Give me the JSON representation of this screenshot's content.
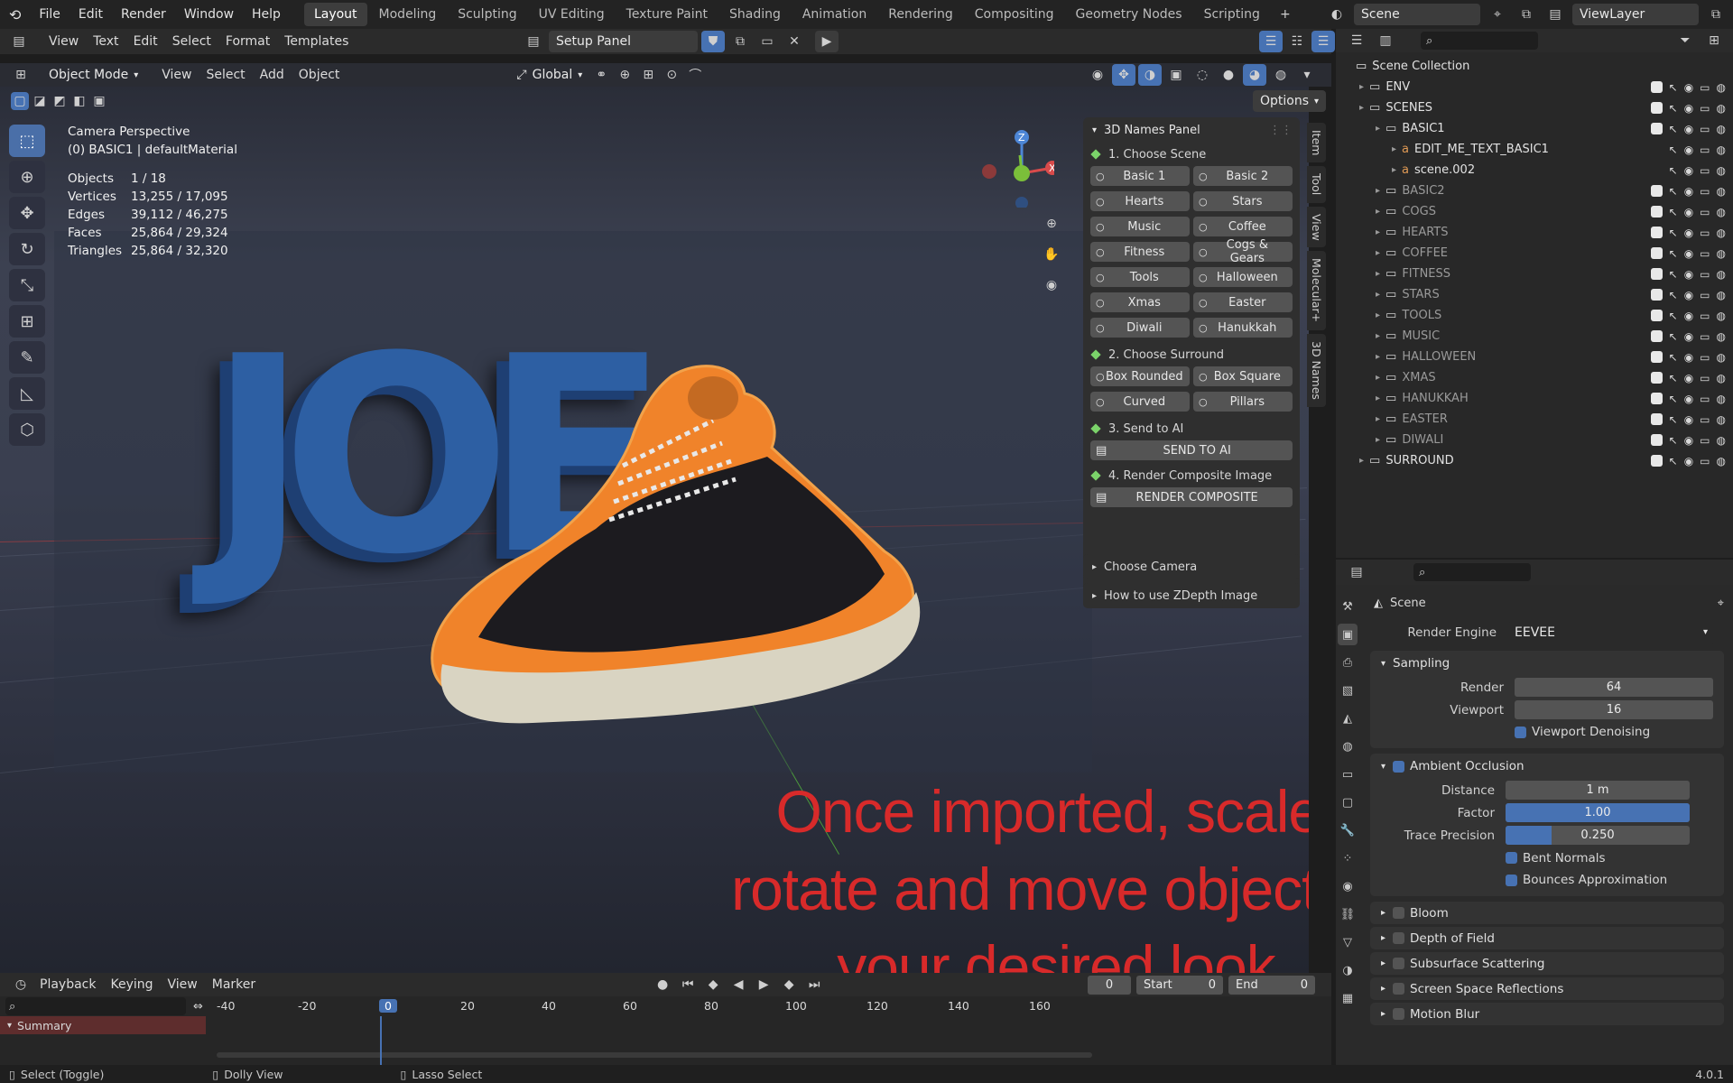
{
  "topbar": {
    "menus": [
      "File",
      "Edit",
      "Render",
      "Window",
      "Help"
    ],
    "workspaces": [
      "Layout",
      "Modeling",
      "Sculpting",
      "UV Editing",
      "Texture Paint",
      "Shading",
      "Animation",
      "Rendering",
      "Compositing",
      "Geometry Nodes",
      "Scripting"
    ],
    "active_workspace": "Layout",
    "scene_name": "Scene",
    "view_layer": "ViewLayer"
  },
  "text_header": {
    "menus": [
      "View",
      "Text",
      "Edit",
      "Select",
      "Format",
      "Templates"
    ],
    "file_name": "Setup Panel"
  },
  "viewport_header": {
    "mode": "Object Mode",
    "menus": [
      "View",
      "Select",
      "Add",
      "Object"
    ],
    "orientation": "Global",
    "options": "Options"
  },
  "viewport": {
    "camera_title": "Camera Perspective",
    "camera_sub": "(0) BASIC1 | defaultMaterial",
    "stats": [
      {
        "label": "Objects",
        "value": "1 / 18"
      },
      {
        "label": "Vertices",
        "value": "13,255 / 17,095"
      },
      {
        "label": "Edges",
        "value": "39,112 / 46,275"
      },
      {
        "label": "Faces",
        "value": "25,864 / 29,324"
      },
      {
        "label": "Triangles",
        "value": "25,864 / 32,320"
      }
    ],
    "scene_text": "JOE",
    "overlay_lines": [
      "Once imported, scale,",
      "rotate and move object to",
      "your desired look"
    ],
    "overlay_color": "#d82a2a"
  },
  "names_panel": {
    "title": "3D Names Panel",
    "step1": "1. Choose Scene",
    "scene_buttons": [
      [
        "Basic 1",
        "Basic 2"
      ],
      [
        "Hearts",
        "Stars"
      ],
      [
        "Music",
        "Coffee"
      ],
      [
        "Fitness",
        "Cogs & Gears"
      ],
      [
        "Tools",
        "Halloween"
      ],
      [
        "Xmas",
        "Easter"
      ],
      [
        "Diwali",
        "Hanukkah"
      ]
    ],
    "step2": "2. Choose Surround",
    "surround_buttons": [
      [
        "Box Rounded",
        "Box Square"
      ],
      [
        "Curved",
        "Pillars"
      ]
    ],
    "step3": "3. Send to AI",
    "send_button": "SEND TO AI",
    "step4": "4. Render Composite Image",
    "render_button": "RENDER COMPOSITE",
    "collapsed": [
      "Choose Camera",
      "How to use ZDepth Image"
    ],
    "side_tabs": [
      "Item",
      "Tool",
      "View",
      "Molecular+",
      "3D Names"
    ]
  },
  "outliner": {
    "root": "Scene Collection",
    "rows": [
      {
        "name": "ENV",
        "indent": 1,
        "dim": false
      },
      {
        "name": "SCENES",
        "indent": 1,
        "dim": false
      },
      {
        "name": "BASIC1",
        "indent": 2,
        "dim": false
      },
      {
        "name": "EDIT_ME_TEXT_BASIC1",
        "indent": 3,
        "dim": false
      },
      {
        "name": "scene.002",
        "indent": 3,
        "dim": false
      },
      {
        "name": "BASIC2",
        "indent": 2,
        "dim": true
      },
      {
        "name": "COGS",
        "indent": 2,
        "dim": true
      },
      {
        "name": "HEARTS",
        "indent": 2,
        "dim": true
      },
      {
        "name": "COFFEE",
        "indent": 2,
        "dim": true
      },
      {
        "name": "FITNESS",
        "indent": 2,
        "dim": true
      },
      {
        "name": "STARS",
        "indent": 2,
        "dim": true
      },
      {
        "name": "TOOLS",
        "indent": 2,
        "dim": true
      },
      {
        "name": "MUSIC",
        "indent": 2,
        "dim": true
      },
      {
        "name": "HALLOWEEN",
        "indent": 2,
        "dim": true
      },
      {
        "name": "XMAS",
        "indent": 2,
        "dim": true
      },
      {
        "name": "HANUKKAH",
        "indent": 2,
        "dim": true
      },
      {
        "name": "EASTER",
        "indent": 2,
        "dim": true
      },
      {
        "name": "DIWALI",
        "indent": 2,
        "dim": true
      },
      {
        "name": "SURROUND",
        "indent": 1,
        "dim": false
      }
    ]
  },
  "properties": {
    "context": "Scene",
    "render_engine_label": "Render Engine",
    "render_engine": "EEVEE",
    "sampling": "Sampling",
    "render_label": "Render",
    "render_value": "64",
    "viewport_label": "Viewport",
    "viewport_value": "16",
    "denoise": "Viewport Denoising",
    "ao": "Ambient Occlusion",
    "distance_label": "Distance",
    "distance_value": "1 m",
    "factor_label": "Factor",
    "factor_value": "1.00",
    "factor_fraction": 1.0,
    "trace_label": "Trace Precision",
    "trace_value": "0.250",
    "trace_fraction": 0.25,
    "bent": "Bent Normals",
    "bounces": "Bounces Approximation",
    "panels": [
      "Bloom",
      "Depth of Field",
      "Subsurface Scattering",
      "Screen Space Reflections",
      "Motion Blur"
    ]
  },
  "timeline": {
    "menus": [
      "Playback",
      "Keying",
      "View",
      "Marker"
    ],
    "ticks": [
      "-40",
      "-20",
      "0",
      "20",
      "40",
      "60",
      "80",
      "100",
      "120",
      "140",
      "160"
    ],
    "current_frame": "0",
    "start_label": "Start",
    "start_value": "0",
    "end_label": "End",
    "end_value": "0",
    "summary": "Summary"
  },
  "statusbar": {
    "hints": [
      "Select (Toggle)",
      "Dolly View",
      "Lasso Select"
    ],
    "version": "4.0.1"
  }
}
